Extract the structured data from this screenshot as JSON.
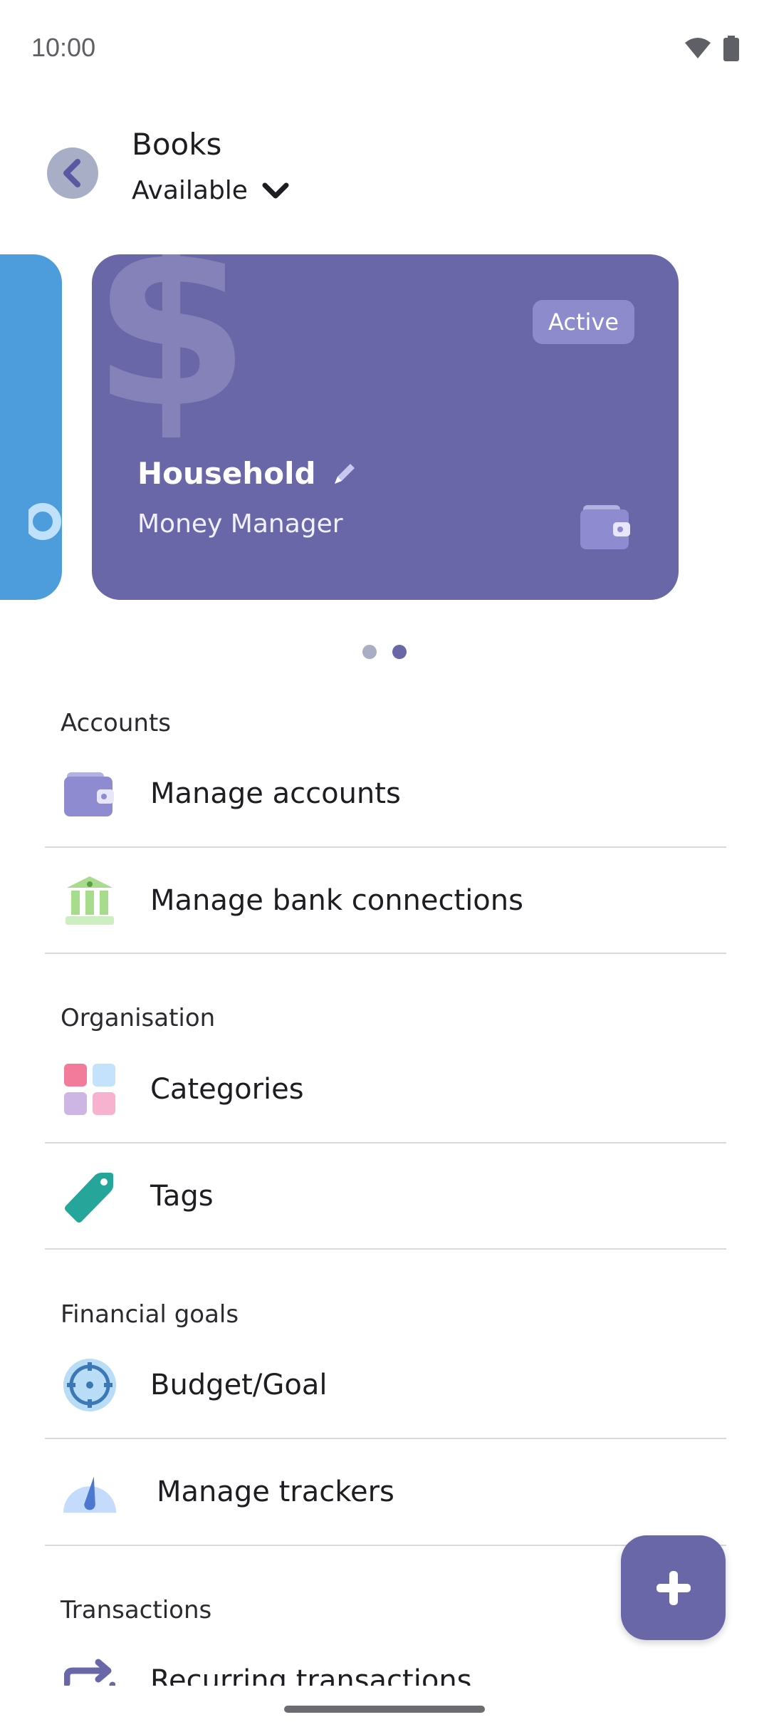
{
  "status_bar": {
    "time": "10:00",
    "icons": [
      "wifi-icon",
      "battery-icon"
    ]
  },
  "header": {
    "title": "Books",
    "subtitle": "Available",
    "back_icon": "chevron-left-icon",
    "dropdown_icon": "chevron-down-icon"
  },
  "cards": [
    {
      "name": "Household",
      "subtitle": "Money Manager",
      "badge": "Active",
      "color": "#6a67a9",
      "icons": [
        "dollar-icon",
        "pencil-icon",
        "wallet-icon"
      ]
    }
  ],
  "carousel": {
    "page_count": 2,
    "active_page": 2
  },
  "sections": {
    "accounts": {
      "title": "Accounts",
      "items": [
        {
          "label": "Manage accounts",
          "icon": "wallet-icon"
        },
        {
          "label": "Manage bank connections",
          "icon": "bank-icon"
        }
      ]
    },
    "organisation": {
      "title": "Organisation",
      "items": [
        {
          "label": "Categories",
          "icon": "categories-grid-icon"
        },
        {
          "label": "Tags",
          "icon": "tag-icon"
        }
      ]
    },
    "financial_goals": {
      "title": "Financial goals",
      "items": [
        {
          "label": "Budget/Goal",
          "icon": "target-icon"
        },
        {
          "label": "Manage trackers",
          "icon": "gauge-icon"
        }
      ]
    },
    "transactions": {
      "title": "Transactions",
      "items": [
        {
          "label": "Recurring transactions",
          "icon": "repeat-arrows-icon"
        }
      ]
    }
  },
  "fab": {
    "icon": "plus-icon"
  },
  "colors": {
    "primary": "#6a67a9",
    "secondary_card": "#4d9cdc",
    "badge": "#8d8bcb",
    "bank_green": "#a8dc8d",
    "tag_teal": "#26a69a"
  }
}
